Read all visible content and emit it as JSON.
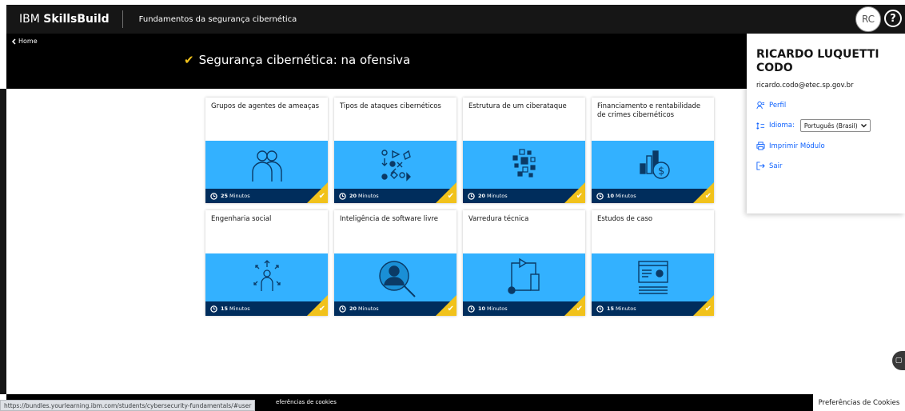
{
  "header": {
    "brand_ibm": "IBM",
    "brand_skillsbuild": "SkillsBuild",
    "course_name": "Fundamentos da segurança cibernética",
    "avatar_initials": "RC",
    "help_glyph": "?"
  },
  "band": {
    "home_label": "Home",
    "module_title": "Segurança cibernética: na ofensiva"
  },
  "cards": [
    {
      "title": "Grupos de agentes de ameaças",
      "minutes": "25",
      "unit": "Minutos",
      "icon": "people-group-icon",
      "completed": true
    },
    {
      "title": "Tipos de ataques cibernéticos",
      "minutes": "20",
      "unit": "Minutos",
      "icon": "shapes-scatter-icon",
      "completed": true
    },
    {
      "title": "Estrutura de um ciberataque",
      "minutes": "20",
      "unit": "Minutos",
      "icon": "blocks-scatter-icon",
      "completed": true
    },
    {
      "title": "Financiamento e rentabilidade de crimes cibernéticos",
      "minutes": "10",
      "unit": "Minutos",
      "icon": "money-chart-icon",
      "completed": true
    },
    {
      "title": "Engenharia social",
      "minutes": "15",
      "unit": "Minutos",
      "icon": "person-arrows-icon",
      "completed": true
    },
    {
      "title": "Inteligência de software livre",
      "minutes": "20",
      "unit": "Minutos",
      "icon": "person-search-icon",
      "completed": true
    },
    {
      "title": "Varredura técnica",
      "minutes": "10",
      "unit": "Minutos",
      "icon": "flow-path-icon",
      "completed": true
    },
    {
      "title": "Estudos de caso",
      "minutes": "15",
      "unit": "Minutos",
      "icon": "document-browser-icon",
      "completed": true
    }
  ],
  "user_panel": {
    "name": "RICARDO LUQUETTI CODO",
    "email": "ricardo.codo@etec.sp.gov.br",
    "perfil_label": "Perfil",
    "idioma_label": "Idioma:",
    "language_selected": "Português (Brasil)",
    "imprimir_label": "Imprimir Módulo",
    "sair_label": "Sair"
  },
  "footer": {
    "status_url": "https://bundles.yourlearning.ibm.com/students/cybersecurity-fundamentals/#user",
    "cookie_link": "eferências de cookies",
    "cookie_box": "Preferências de Cookies"
  },
  "colors": {
    "header_bg": "#161616",
    "card_image_bg": "#33b1ff",
    "card_footer_bg": "#002d5c",
    "completed_accent": "#f1c21b",
    "link_blue": "#0f62fe"
  }
}
